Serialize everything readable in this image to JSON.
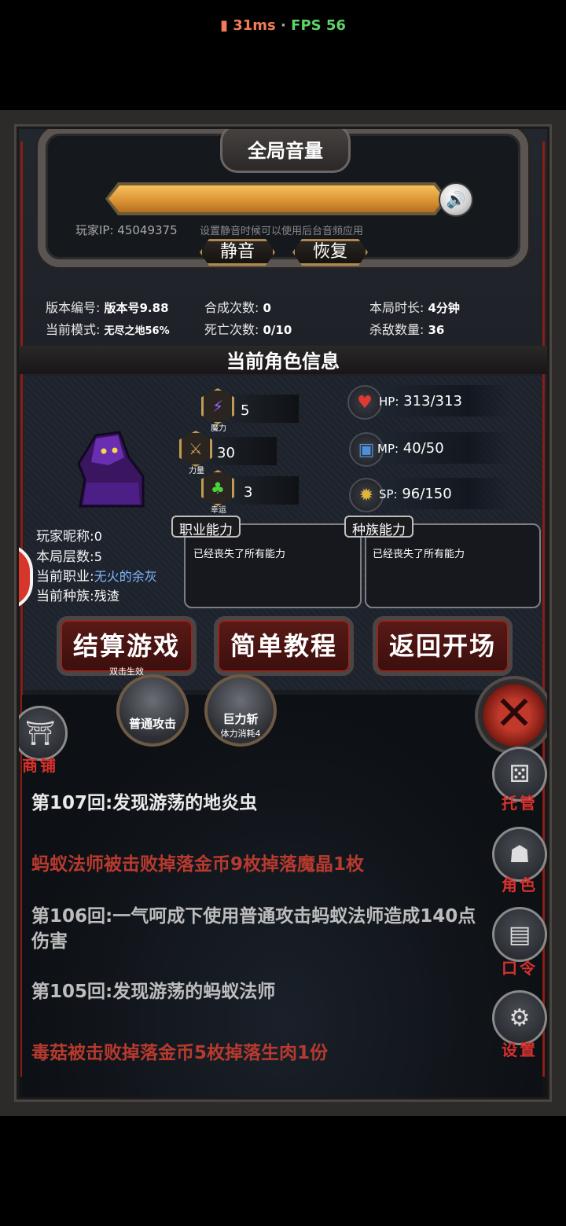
{
  "status": {
    "ping": "31ms",
    "separator": " · ",
    "fps": "FPS 56"
  },
  "volume": {
    "title": "全局音量",
    "level_percent": 100,
    "player_ip": "玩家IP: 45049375",
    "hint": "设置静音时候可以使用后台音频应用",
    "mute_label": "静音",
    "restore_label": "恢复"
  },
  "stats": {
    "version_label": "版本编号:",
    "version_value": "版本号9.88",
    "mode_label": "当前模式:",
    "mode_value": "无尽之地56%",
    "craft_label": "合成次数:",
    "craft_value": "0",
    "death_label": "死亡次数:",
    "death_value": "0/10",
    "time_label": "本局时长:",
    "time_value": "4分钟",
    "kill_label": "杀敌数量:",
    "kill_value": "36"
  },
  "character": {
    "section_title": "当前角色信息",
    "attributes": [
      {
        "name": "魔力",
        "value": "5",
        "icon": "lightning-icon"
      },
      {
        "name": "力量",
        "value": "30",
        "icon": "sword-icon"
      },
      {
        "name": "幸运",
        "value": "3",
        "icon": "clover-icon"
      }
    ],
    "hp_label": "HP:",
    "hp_value": "313/313",
    "mp_label": "MP:",
    "mp_value": "40/50",
    "sp_label": "SP:",
    "sp_value": "96/150",
    "nickname_label": "玩家昵称:",
    "nickname_value": "0",
    "floor_label": "本局层数:",
    "floor_value": "5",
    "job_label": "当前职业:",
    "job_value": "无火的余灰",
    "race_label": "当前种族:",
    "race_value": "残渣",
    "job_ability_title": "职业能力",
    "race_ability_title": "种族能力",
    "job_ability_text": "已经丧失了所有能力",
    "race_ability_text": "已经丧失了所有能力"
  },
  "actions": {
    "settle_label": "结算游戏",
    "settle_sub": "双击生效",
    "tutorial_label": "简单教程",
    "return_label": "返回开场"
  },
  "skills": [
    {
      "name": "普通攻击",
      "sub": ""
    },
    {
      "name": "巨力斩",
      "sub": "体力消耗4"
    }
  ],
  "side_menu": {
    "shop": "商铺",
    "auto": "托管",
    "role": "角色",
    "code": "口令",
    "settings": "设置"
  },
  "log": [
    {
      "text": "第107回:发现游荡的地炎虫",
      "color": "white"
    },
    {
      "text": "蚂蚁法师被击败掉落金币9枚掉落魔晶1枚",
      "color": "red"
    },
    {
      "text": "第106回:一气呵成下使用普通攻击蚂蚁法师造成140点伤害",
      "color": "grey"
    },
    {
      "text": "第105回:发现游荡的蚂蚁法师",
      "color": "grey"
    },
    {
      "text": "毒菇被击败掉落金币5枚掉落生肉1份",
      "color": "red"
    }
  ],
  "bottom": {
    "player_ip": "玩家IP: 45049375"
  },
  "colors": {
    "accent_red": "#b83a2e",
    "gold": "#c19a54",
    "volume_bar": "#f2b14f"
  }
}
